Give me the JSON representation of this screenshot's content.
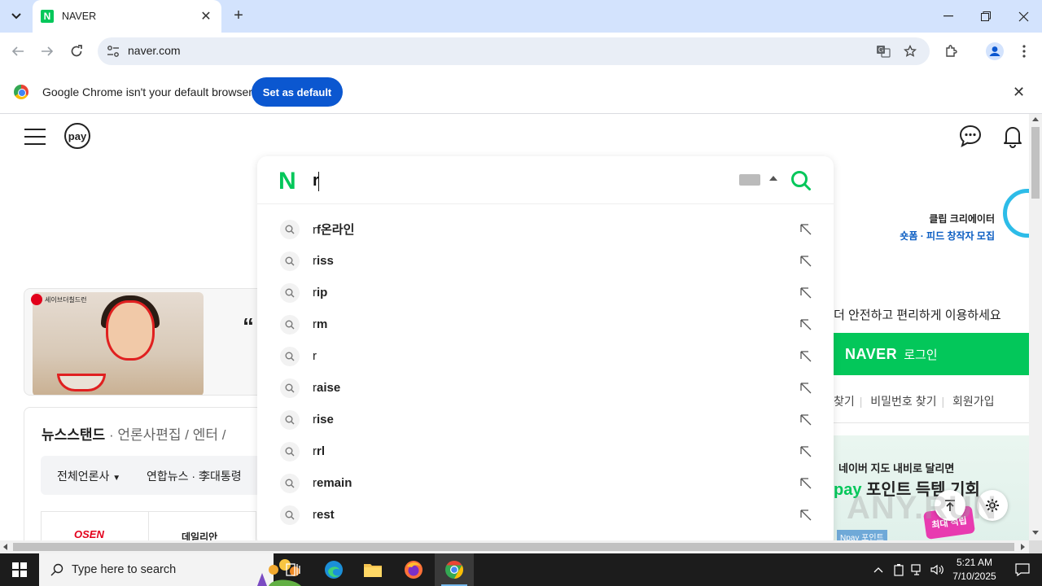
{
  "browser": {
    "tab": {
      "title": "NAVER",
      "favicon_letter": "N"
    },
    "url": "naver.com",
    "infobar": {
      "message": "Google Chrome isn't your default browser",
      "button": "Set as default"
    }
  },
  "page": {
    "pay_label": "pay",
    "clip_promo": {
      "line1": "클립 크리에이터",
      "line2": "숏폼 · 피드 창작자 모집"
    },
    "banner": {
      "brand": "세이브더칠드런",
      "quote": "“"
    },
    "newsstand": {
      "title": "뉴스스탠드",
      "tab_publisher": "언론사편집",
      "tab_enter": "엔터",
      "sep1": "·",
      "sep2": "/",
      "sep3": "/"
    },
    "news_filter": {
      "all": "전체언론사",
      "headline": "연합뉴스 · 李대통령"
    },
    "news_logos": {
      "osen": "OSEN",
      "daily": "데일리안"
    },
    "login": {
      "desc": "더 안전하고 편리하게 이용하세요",
      "brand": "NAVER",
      "label": "로그인",
      "links": [
        "찾기",
        "비밀번호 찾기",
        "회원가입"
      ]
    },
    "ad": {
      "line1": "네이버 지도 내비로 달리면",
      "line2_prefix": "pay",
      "line2_rest": " 포인트 득템 기회",
      "line3": "Npay 포인트",
      "reward": "최대\n적립"
    },
    "search": {
      "logo": "N",
      "query": "r",
      "suggestions": [
        {
          "typed": "r",
          "rest": "f온라인"
        },
        {
          "typed": "r",
          "rest": "iss"
        },
        {
          "typed": "r",
          "rest": "ip"
        },
        {
          "typed": "r",
          "rest": "m"
        },
        {
          "typed": "r",
          "rest": ""
        },
        {
          "typed": "r",
          "rest": "aise"
        },
        {
          "typed": "r",
          "rest": "ise"
        },
        {
          "typed": "r",
          "rest": "rl"
        },
        {
          "typed": "r",
          "rest": "emain"
        },
        {
          "typed": "r",
          "rest": "est"
        }
      ]
    },
    "watermark": "ANY.RUN"
  },
  "taskbar": {
    "search_placeholder": "Type here to search",
    "time": "5:21 AM",
    "date": "7/10/2025"
  },
  "colors": {
    "naver_green": "#03c75a",
    "chrome_blue": "#0b57d0",
    "tab_strip": "#d3e3fd"
  }
}
